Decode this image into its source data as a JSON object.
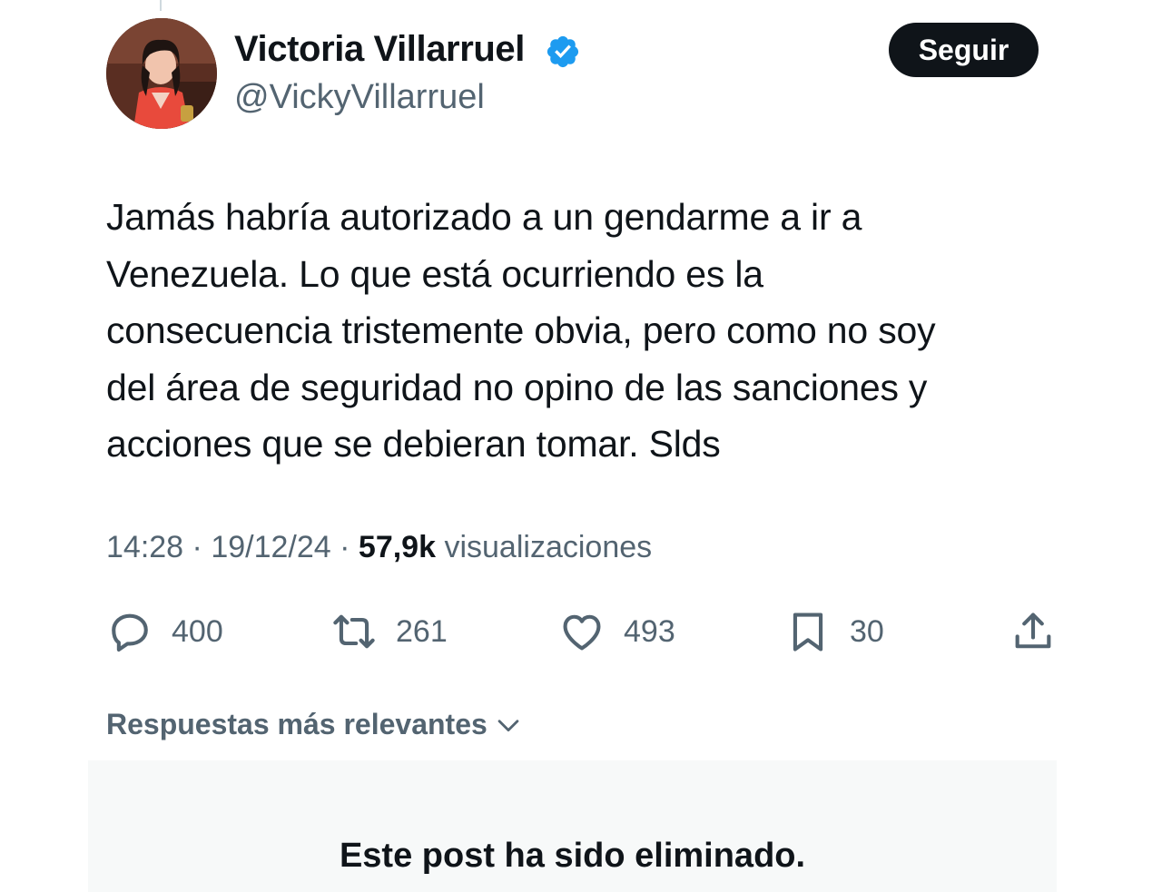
{
  "author": {
    "display_name": "Victoria Villarruel",
    "handle": "@VickyVillarruel",
    "verified": true,
    "verified_color": "#1d9bf0"
  },
  "follow_button": {
    "label": "Seguir"
  },
  "tweet": {
    "text_lines": [
      "Jamás habría autorizado a un gendarme a ir a",
      "Venezuela. Lo que está ocurriendo es la",
      "consecuencia tristemente obvia, pero como no soy",
      "del área de seguridad no opino de las sanciones y",
      "acciones que se debieran tomar. Slds"
    ],
    "time": "14:28",
    "date": "19/12/24",
    "separator": "·",
    "views": "57,9k",
    "views_label": "visualizaciones"
  },
  "actions": {
    "replies": {
      "icon": "reply-icon",
      "count": "400"
    },
    "reposts": {
      "icon": "repost-icon",
      "count": "261"
    },
    "likes": {
      "icon": "heart-icon",
      "count": "493"
    },
    "bookmarks": {
      "icon": "bookmark-icon",
      "count": "30"
    },
    "share": {
      "icon": "share-icon"
    }
  },
  "replies_section": {
    "sort_label": "Respuestas más relevantes",
    "deleted_notice": "Este post ha sido eliminado."
  },
  "colors": {
    "text": "#0f1419",
    "secondary": "#536471",
    "button_bg": "#0f1419",
    "deleted_bg": "#f7f9f9"
  }
}
